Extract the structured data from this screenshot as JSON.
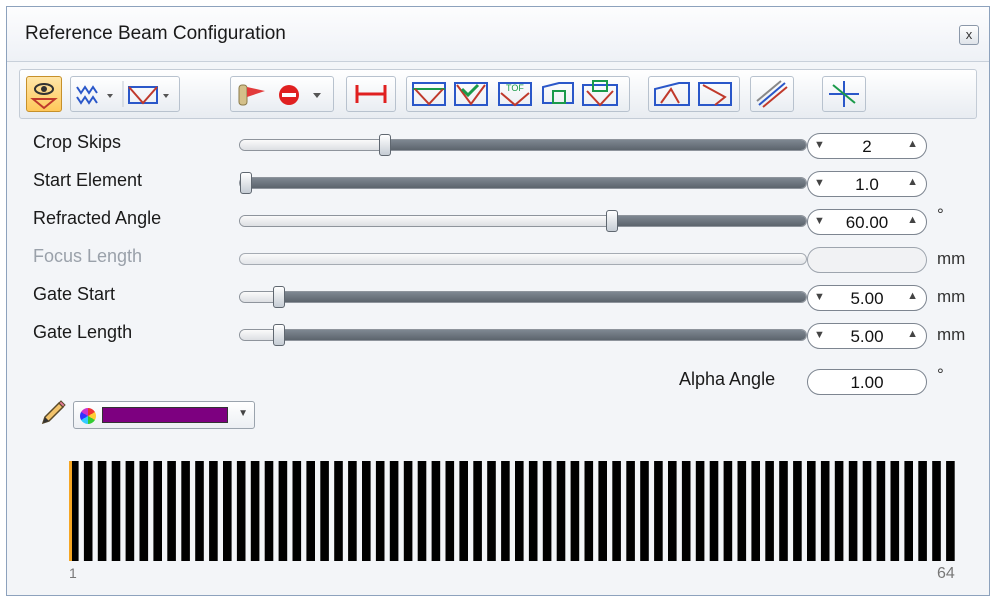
{
  "window": {
    "title": "Reference Beam Configuration",
    "close_glyph": "x"
  },
  "toolbar": {
    "buttons": [
      {
        "name": "view-eye-button",
        "icon": "eye-beam-icon",
        "active": true
      },
      {
        "name": "waveform-dropdown-button",
        "icon": "waveform-icon"
      },
      {
        "name": "beam-shape-dropdown-button",
        "icon": "beam-shape-icon"
      },
      {
        "name": "probe-dropdown-button",
        "icon": "probe-stop-icon"
      },
      {
        "name": "measure-span-button",
        "icon": "span-measure-icon"
      },
      {
        "name": "beam-cone-button",
        "icon": "beam-cone-icon"
      },
      {
        "name": "beam-cone-check-button",
        "icon": "beam-cone-check-icon"
      },
      {
        "name": "tof-button",
        "icon": "tof-icon",
        "label": "TOF"
      },
      {
        "name": "wedge-button",
        "icon": "wedge-icon"
      },
      {
        "name": "wedge-beam-button",
        "icon": "wedge-beam-icon"
      },
      {
        "name": "refract-left-button",
        "icon": "refract-left-icon"
      },
      {
        "name": "refract-right-button",
        "icon": "refract-right-icon"
      },
      {
        "name": "rays-button",
        "icon": "rays-icon"
      },
      {
        "name": "crosshair-button",
        "icon": "crosshair-icon"
      }
    ]
  },
  "params": [
    {
      "label": "Crop Skips",
      "value": "2",
      "unit": "",
      "fraction": 0.25,
      "enabled": true
    },
    {
      "label": "Start Element",
      "value": "1.0",
      "unit": "",
      "fraction": 0.0,
      "enabled": true
    },
    {
      "label": "Refracted Angle",
      "value": "60.00",
      "unit": "°",
      "fraction": 0.66,
      "enabled": true
    },
    {
      "label": "Focus Length",
      "value": "",
      "unit": "mm",
      "fraction": null,
      "enabled": false
    },
    {
      "label": "Gate Start",
      "value": "5.00",
      "unit": "mm",
      "fraction": 0.06,
      "enabled": true
    },
    {
      "label": "Gate Length",
      "value": "5.00",
      "unit": "mm",
      "fraction": 0.06,
      "enabled": true
    }
  ],
  "alpha": {
    "label": "Alpha Angle",
    "value": "1.00",
    "unit": "°"
  },
  "color": {
    "selected": "#7d0080"
  },
  "elements": {
    "count": 64,
    "first_label": "1",
    "last_label": "64",
    "selected": 1,
    "bar_color": "#000000",
    "selected_color": "#f5a623"
  },
  "colors": {
    "accent": "#ffc85a",
    "track_dark": "#5c646d"
  }
}
